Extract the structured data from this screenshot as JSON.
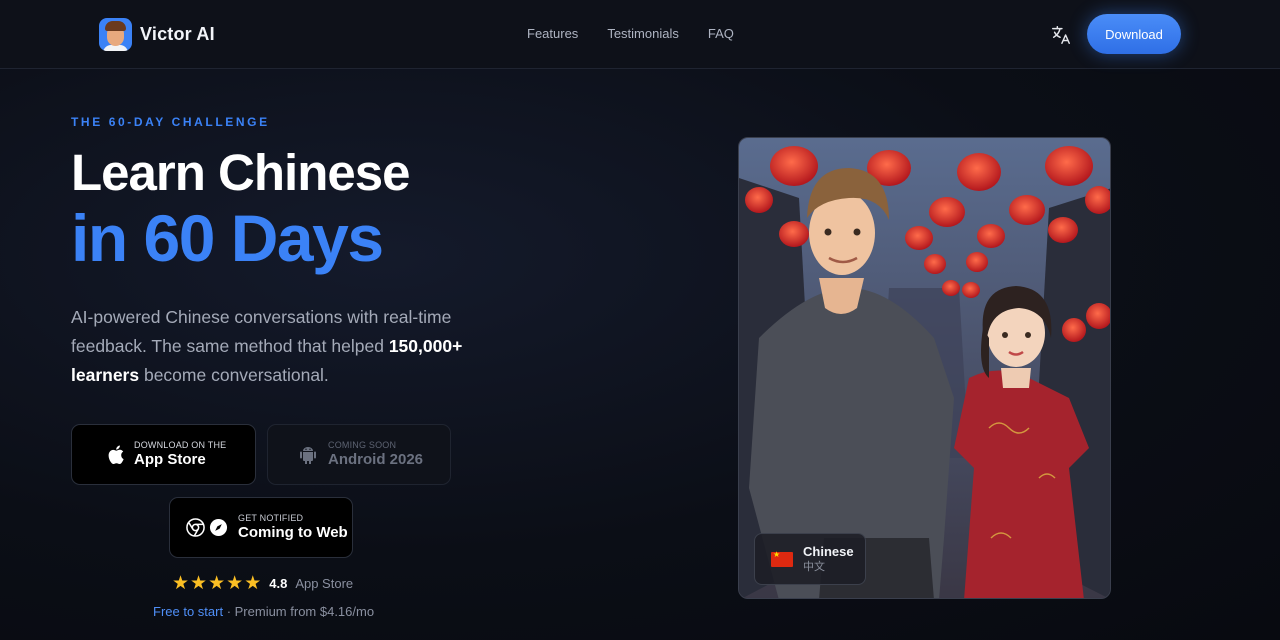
{
  "nav": {
    "brand": "Victor AI",
    "links": [
      "Features",
      "Testimonials",
      "FAQ"
    ],
    "download_label": "Download",
    "icons": {
      "language": "translate-icon",
      "logo": "avatar-logo"
    }
  },
  "hero": {
    "eyebrow": "THE 60-DAY CHALLENGE",
    "title_line1": "Learn Chinese",
    "title_line2": "in 60 Days",
    "description_part1": "AI-powered Chinese conversations with real-time feedback. The same method that helped ",
    "description_bold": "150,000+ learners",
    "description_part2": " become conversational.",
    "buttons": {
      "app_store": {
        "small": "Download on the",
        "big": "App Store",
        "icon": "apple-icon"
      },
      "android": {
        "small": "Coming soon",
        "big": "Android 2026",
        "icon": "android-icon"
      },
      "web": {
        "small": "Get notified",
        "big": "Coming to Web",
        "icons": [
          "chrome-icon",
          "safari-icon"
        ]
      }
    },
    "rating": {
      "stars": 5,
      "value": "4.8",
      "source": "App Store"
    },
    "pricing": {
      "free": "Free to start",
      "rest": " · Premium from $4.16/mo"
    },
    "language_card": {
      "name": "Chinese",
      "native": "中文",
      "flag": "china-flag-icon"
    }
  },
  "colors": {
    "accent": "#3b82f6",
    "background": "#0b0e16",
    "star": "#fbbf24"
  }
}
